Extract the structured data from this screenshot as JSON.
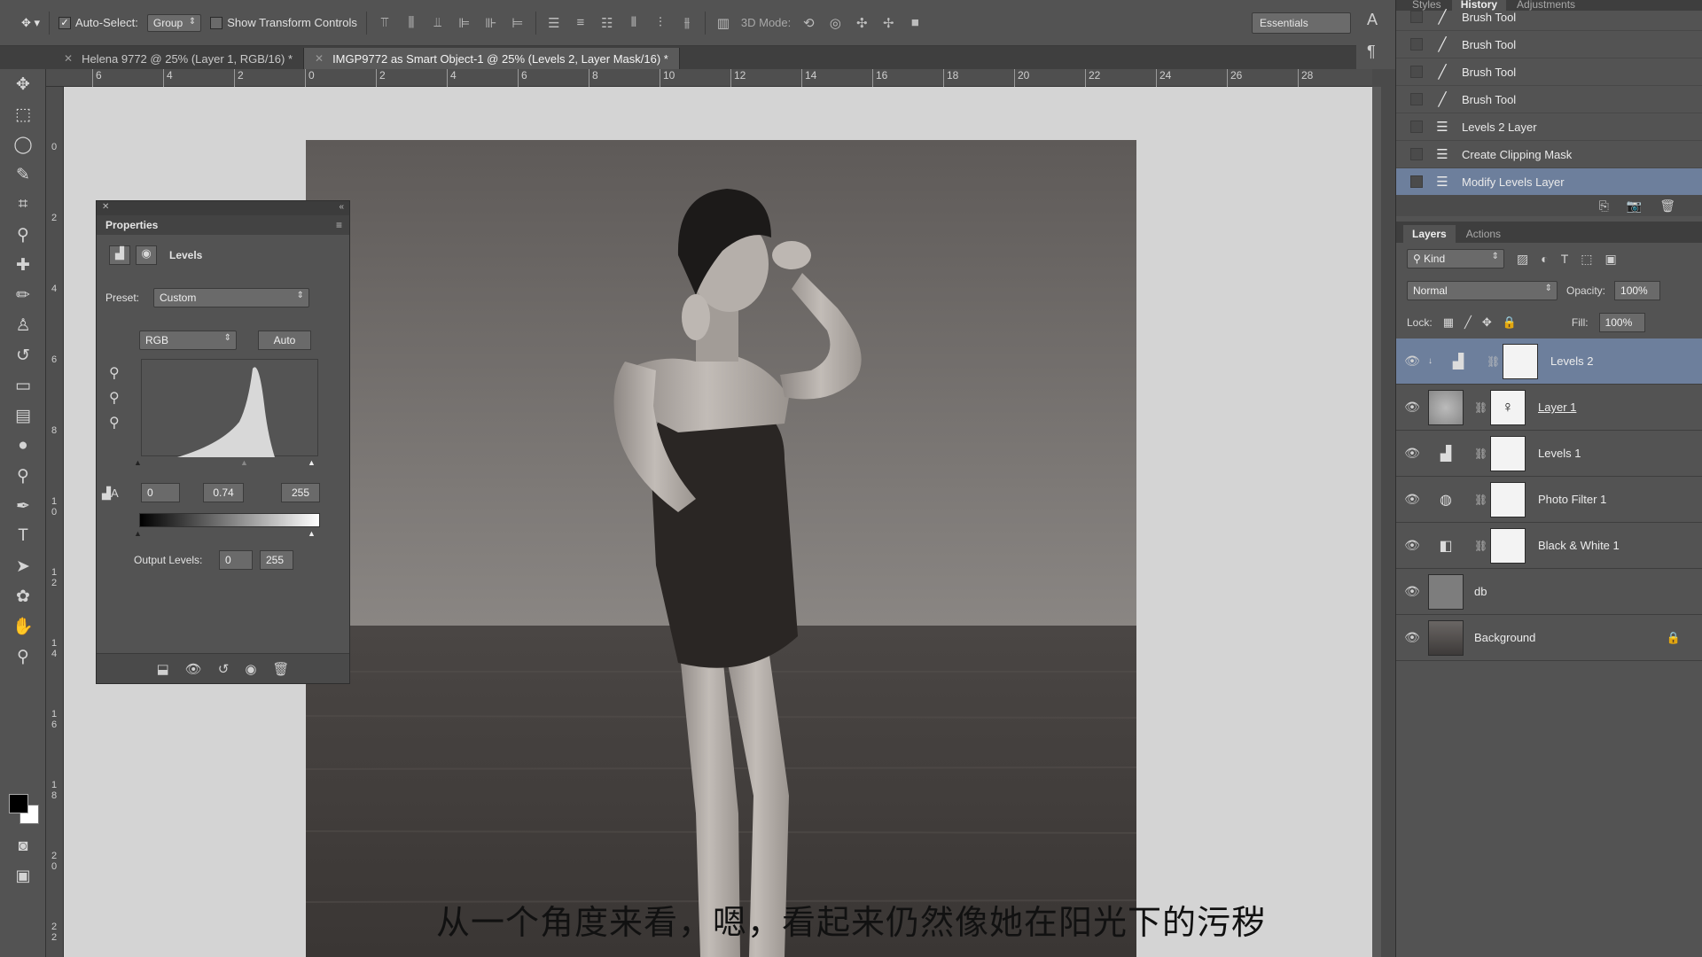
{
  "options_bar": {
    "auto_select_label": "Auto-Select:",
    "auto_select_value": "Group",
    "show_transform_label": "Show Transform Controls",
    "mode_3d_label": "3D Mode:",
    "workspace": "Essentials"
  },
  "doc_tabs": [
    {
      "label": "Helena 9772 @ 25% (Layer 1, RGB/16) *",
      "active": false
    },
    {
      "label": "IMGP9772 as Smart Object-1 @ 25% (Levels 2, Layer Mask/16) *",
      "active": true
    }
  ],
  "ruler_h": [
    "6",
    "4",
    "2",
    "0",
    "2",
    "4",
    "6",
    "8",
    "10",
    "12",
    "14",
    "16",
    "18",
    "20",
    "22",
    "24",
    "26",
    "28"
  ],
  "ruler_v": [
    "0",
    "2",
    "4",
    "6",
    "8",
    "1 0",
    "1 2",
    "1 4",
    "1 6",
    "1 8",
    "2 0",
    "2 2"
  ],
  "properties": {
    "title": "Properties",
    "adjustment": "Levels",
    "preset_label": "Preset:",
    "preset_value": "Custom",
    "channel": "RGB",
    "auto_label": "Auto",
    "input_black": "0",
    "input_gamma": "0.74",
    "input_white": "255",
    "output_label": "Output Levels:",
    "output_black": "0",
    "output_white": "255"
  },
  "history": {
    "tabs": [
      "Styles",
      "History",
      "Adjustments"
    ],
    "active_tab": "History",
    "items": [
      {
        "label": "Brush Tool",
        "icon": "brush-icon"
      },
      {
        "label": "Brush Tool",
        "icon": "brush-icon"
      },
      {
        "label": "Brush Tool",
        "icon": "brush-icon"
      },
      {
        "label": "Brush Tool",
        "icon": "brush-icon"
      },
      {
        "label": "Levels 2 Layer",
        "icon": "document-icon"
      },
      {
        "label": "Create Clipping Mask",
        "icon": "document-icon"
      },
      {
        "label": "Modify Levels Layer",
        "icon": "document-icon",
        "selected": true
      }
    ]
  },
  "layers": {
    "tabs": [
      "Layers",
      "Actions"
    ],
    "kind_label": "Kind",
    "blend_mode": "Normal",
    "opacity_label": "Opacity:",
    "opacity_value": "100%",
    "lock_label": "Lock:",
    "fill_label": "Fill:",
    "fill_value": "100%",
    "items": [
      {
        "name": "Levels 2",
        "selected": true
      },
      {
        "name": "Layer 1"
      },
      {
        "name": "Levels 1"
      },
      {
        "name": "Photo Filter 1"
      },
      {
        "name": "Black & White 1"
      },
      {
        "name": "db"
      },
      {
        "name": "Background"
      }
    ]
  },
  "subtitle": "从一个角度来看，嗯，看起来仍然像她在阳光下的污秽"
}
